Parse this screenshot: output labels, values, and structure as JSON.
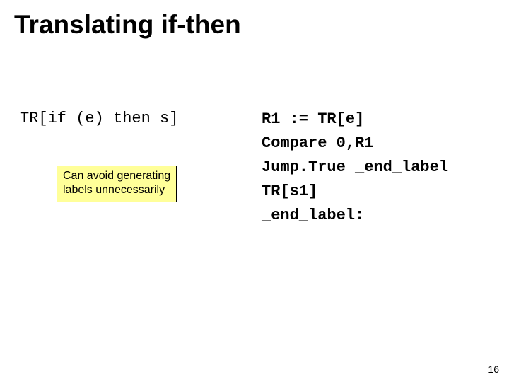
{
  "title": "Translating if-then",
  "left": {
    "expr": "TR[if (e) then s]"
  },
  "note": {
    "line1": "Can avoid generating",
    "line2": "labels unnecessarily"
  },
  "code": {
    "l1": "R1 := TR[e]",
    "l2": "Compare 0,R1",
    "l3": "Jump.True _end_label",
    "l4": "TR[s1]",
    "l5": "_end_label:"
  },
  "page_number": "16"
}
